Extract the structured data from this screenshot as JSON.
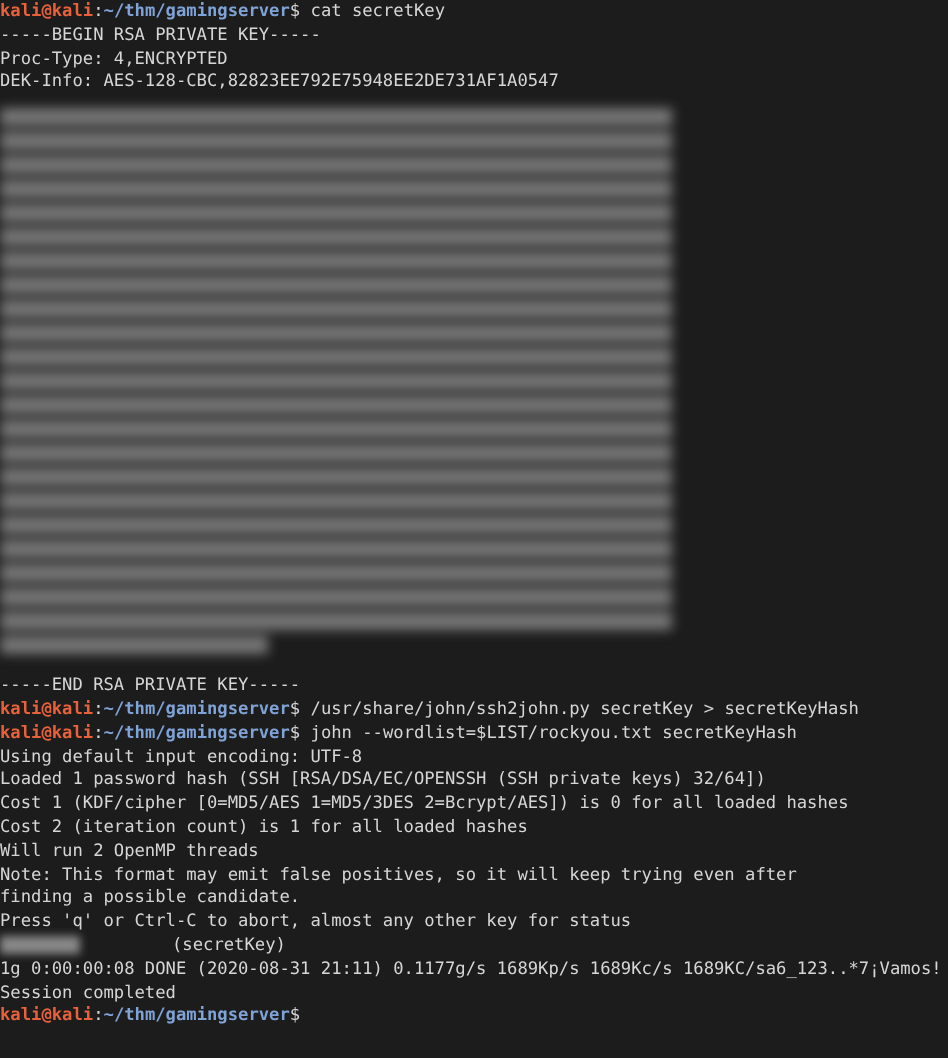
{
  "terminal": {
    "lines": [
      {
        "kind": "prompt",
        "user": "kali@kali",
        "separator": ":",
        "path": "~/thm/gamingserver",
        "symbol": "$",
        "command": " cat secretKey"
      },
      {
        "kind": "output",
        "text": "-----BEGIN RSA PRIVATE KEY-----"
      },
      {
        "kind": "output",
        "text": "Proc-Type: 4,ENCRYPTED"
      },
      {
        "kind": "output",
        "text": "DEK-Info: AES-128-CBC,82823EE792E75948EE2DE731AF1A0547"
      },
      {
        "kind": "redacted"
      },
      {
        "kind": "output",
        "text": "-----END RSA PRIVATE KEY-----"
      },
      {
        "kind": "prompt",
        "user": "kali@kali",
        "separator": ":",
        "path": "~/thm/gamingserver",
        "symbol": "$",
        "command": " /usr/share/john/ssh2john.py secretKey > secretKeyHash"
      },
      {
        "kind": "prompt",
        "user": "kali@kali",
        "separator": ":",
        "path": "~/thm/gamingserver",
        "symbol": "$",
        "command": " john --wordlist=$LIST/rockyou.txt secretKeyHash"
      },
      {
        "kind": "output",
        "text": "Using default input encoding: UTF-8"
      },
      {
        "kind": "output",
        "text": "Loaded 1 password hash (SSH [RSA/DSA/EC/OPENSSH (SSH private keys) 32/64])"
      },
      {
        "kind": "output",
        "text": "Cost 1 (KDF/cipher [0=MD5/AES 1=MD5/3DES 2=Bcrypt/AES]) is 0 for all loaded hashes"
      },
      {
        "kind": "output",
        "text": "Cost 2 (iteration count) is 1 for all loaded hashes"
      },
      {
        "kind": "output",
        "text": "Will run 2 OpenMP threads"
      },
      {
        "kind": "output",
        "text": "Note: This format may emit false positives, so it will keep trying even after"
      },
      {
        "kind": "output",
        "text": "finding a possible candidate."
      },
      {
        "kind": "output",
        "text": "Press 'q' or Ctrl-C to abort, almost any other key for status"
      },
      {
        "kind": "cracked",
        "text": "(secretKey)"
      },
      {
        "kind": "output",
        "text": "1g 0:00:00:08 DONE (2020-08-31 21:11) 0.1177g/s 1689Kp/s 1689Kc/s 1689KC/sa6_123..*7¡Vamos!"
      },
      {
        "kind": "output",
        "text": "Session completed"
      },
      {
        "kind": "prompt",
        "user": "kali@kali",
        "separator": ":",
        "path": "~/thm/gamingserver",
        "symbol": "$"
      }
    ]
  }
}
